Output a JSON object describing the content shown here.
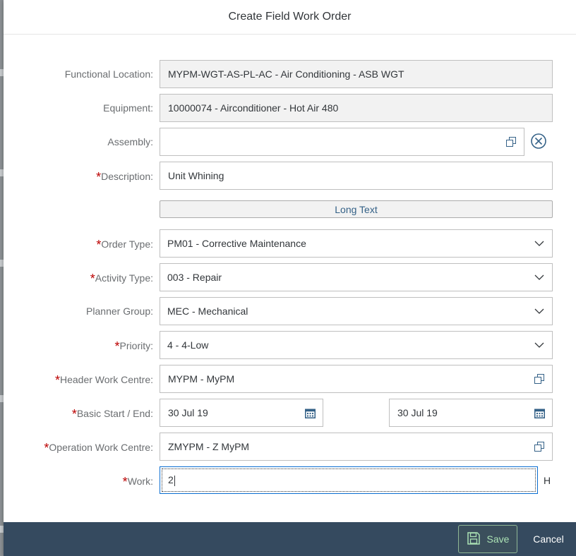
{
  "dialog": {
    "title": "Create Field Work Order"
  },
  "fields": {
    "functional_location": {
      "label": "Functional Location:",
      "value": "MYPM-WGT-AS-PL-AC - Air Conditioning - ASB WGT"
    },
    "equipment": {
      "label": "Equipment:",
      "value": "10000074 - Airconditioner - Hot Air 480"
    },
    "assembly": {
      "label": "Assembly:",
      "value": ""
    },
    "description": {
      "label": "Description:",
      "value": "Unit Whining"
    },
    "long_text_button": "Long Text",
    "order_type": {
      "label": "Order Type:",
      "value": "PM01 - Corrective Maintenance"
    },
    "activity_type": {
      "label": "Activity Type:",
      "value": "003 - Repair"
    },
    "planner_group": {
      "label": "Planner Group:",
      "value": "MEC - Mechanical"
    },
    "priority": {
      "label": "Priority:",
      "value": "4 - 4-Low"
    },
    "header_work_centre": {
      "label": "Header Work Centre:",
      "value": "MYPM - MyPM"
    },
    "basic_start_end": {
      "label": "Basic Start / End:",
      "start": "30 Jul 19",
      "end": "30 Jul 19"
    },
    "operation_work_centre": {
      "label": "Operation Work Centre:",
      "value": "ZMYPM - Z MyPM"
    },
    "work": {
      "label": "Work:",
      "value": "2",
      "unit": "H"
    }
  },
  "required_marker": "*",
  "footer": {
    "save_label": "Save",
    "cancel_label": "Cancel"
  },
  "colors": {
    "accent": "#0a6ed1",
    "footer_bg": "#354a5f",
    "save_text": "#abe2b4",
    "required": "#bb0000",
    "link": "#346187"
  },
  "icons": {
    "value_help": "value-help-icon",
    "clear": "clear-circle-icon",
    "dropdown": "chevron-down-icon",
    "calendar": "calendar-icon",
    "save": "save-icon"
  }
}
